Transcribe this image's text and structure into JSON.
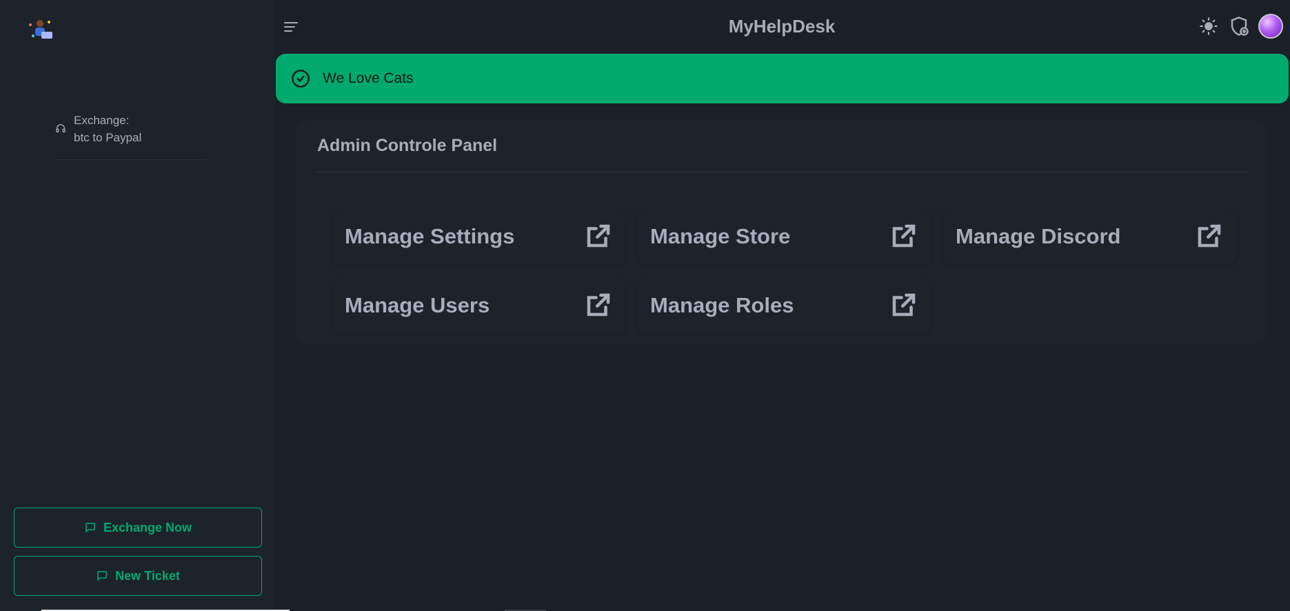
{
  "app": {
    "title": "MyHelpDesk"
  },
  "sidebar": {
    "items": [
      {
        "line1": "Exchange:",
        "line2": "btc to Paypal",
        "icon": "headset-icon"
      }
    ],
    "exchange_button": "Exchange Now",
    "ticket_button": "New Ticket"
  },
  "alert": {
    "message": "We Love Cats",
    "icon": "check-circle-icon",
    "color": "#00a96e"
  },
  "panel": {
    "title": "Admin Controle Panel",
    "cards": [
      {
        "label": "Manage Settings"
      },
      {
        "label": "Manage Store"
      },
      {
        "label": "Manage Discord"
      },
      {
        "label": "Manage Users"
      },
      {
        "label": "Manage Roles"
      }
    ]
  },
  "header_icons": [
    "menu-icon",
    "sun-icon",
    "shield-plus-icon",
    "avatar"
  ],
  "colors": {
    "background": "#1b1f27",
    "sidebar": "#1d232b",
    "accent": "#00a96e",
    "text": "#a6adbb"
  }
}
